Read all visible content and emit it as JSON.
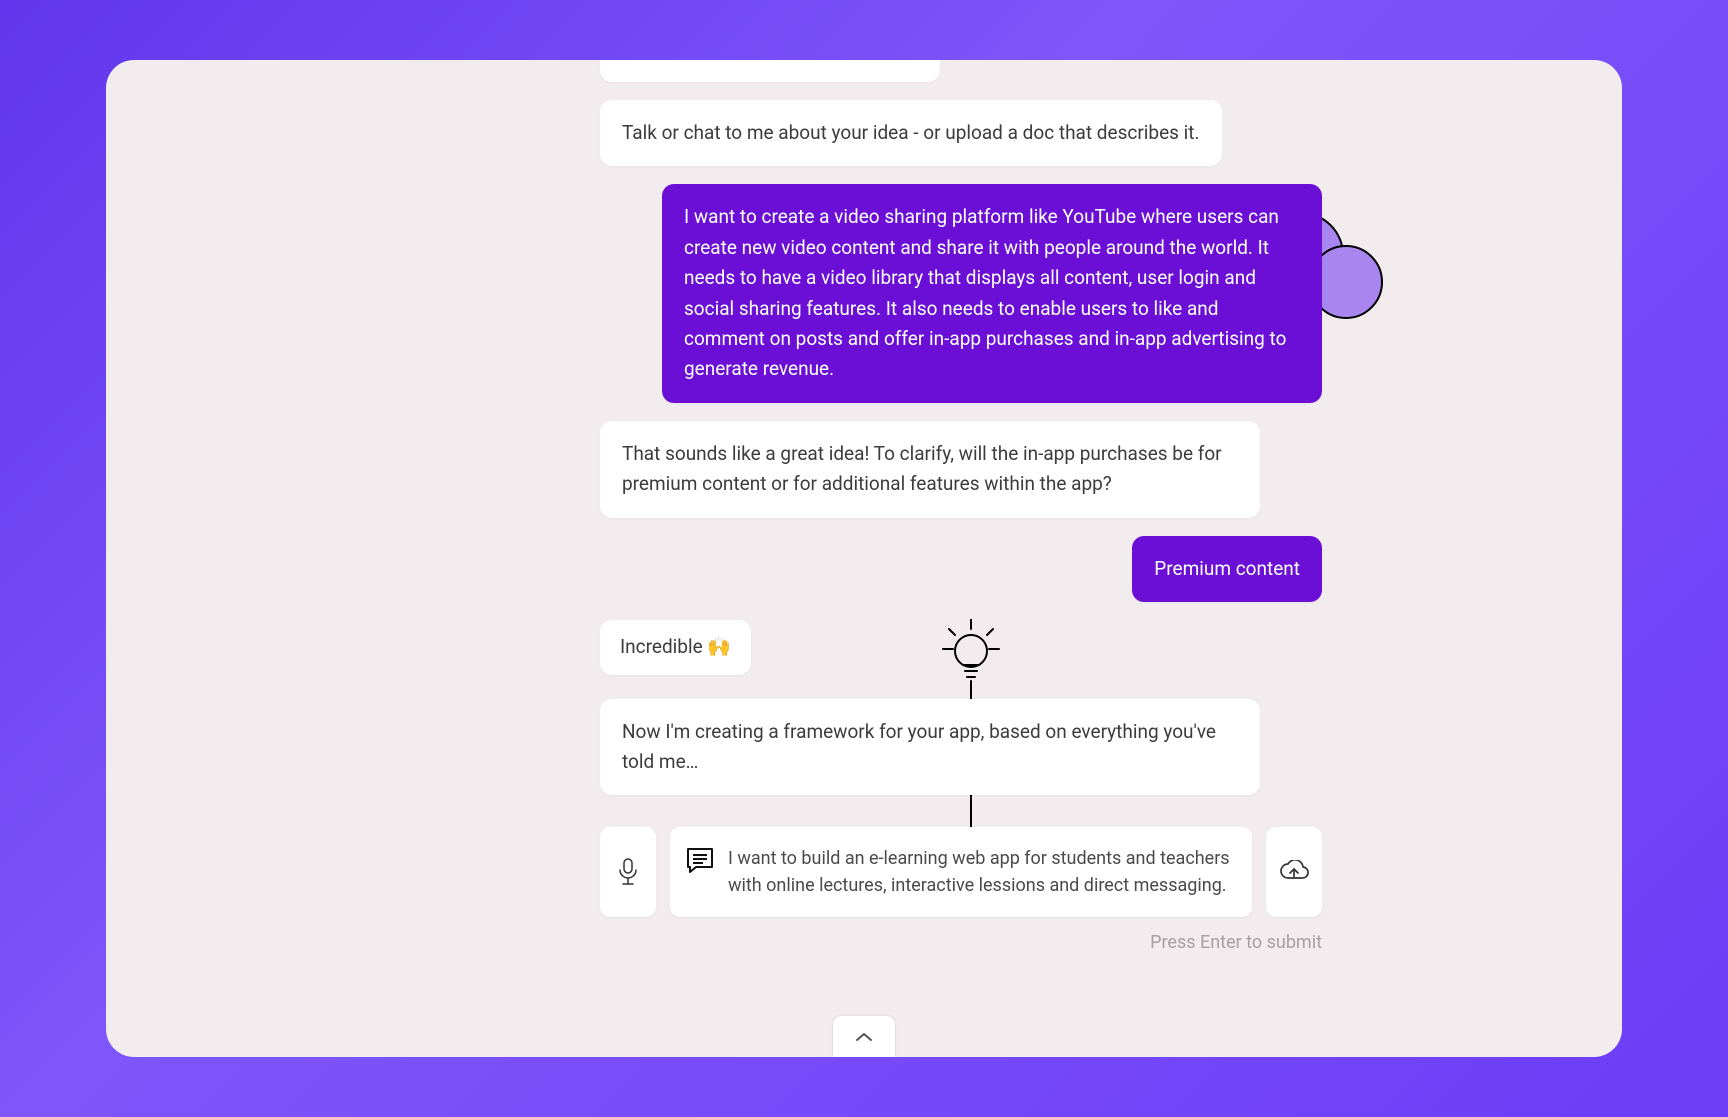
{
  "colors": {
    "bg_gradient_start": "#6136ec",
    "bg_gradient_end": "#6d3cf7",
    "card_bg": "#f2ecee",
    "bot_bubble": "#ffffff",
    "user_bubble": "#6b0ed6",
    "text": "#3c3c3c",
    "hint": "#a5a0a2"
  },
  "messages": {
    "bot_intro": "Talk or chat to me about your idea - or upload a doc that describes it.",
    "user_idea": "I want to create a video sharing platform like YouTube where users can create new video content and share it with people around the world. It needs to have a video library that displays all content, user login and social sharing features. It also needs to enable users to like and comment on posts and offer in-app purchases and in-app advertising to generate revenue.",
    "bot_clarify": "That sounds like a great idea! To clarify, will the in-app purchases be for premium content or for additional features within the app?",
    "user_answer": "Premium content",
    "bot_react": "Incredible 🙌",
    "bot_progress": "Now I'm creating a framework for your app, based on everything you've told me…"
  },
  "input": {
    "placeholder": "I want to build an e-learning web app for students and teachers with online lectures, interactive lessions and direct messaging."
  },
  "hint": "Press Enter to submit",
  "icons": {
    "mic": "mic-icon",
    "chat": "chat-icon",
    "upload": "cloud-upload-icon",
    "chevron": "chevron-up-icon",
    "lightbulb": "lightbulb-icon"
  }
}
